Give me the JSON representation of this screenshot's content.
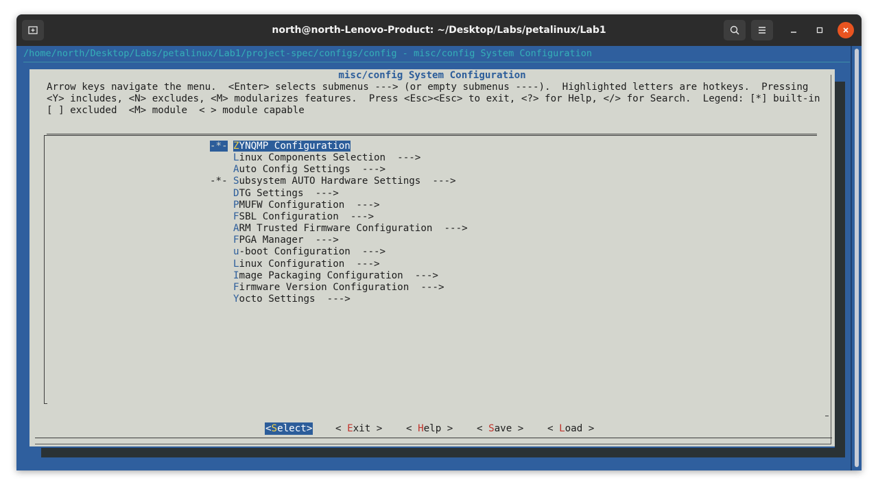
{
  "window": {
    "title": "north@north-Lenovo-Product: ~/Desktop/Labs/petalinux/Lab1"
  },
  "terminal": {
    "path_line": "/home/north/Desktop/Labs/petalinux/Lab1/project-spec/configs/config - misc/config System Configuration"
  },
  "dialog": {
    "title": "misc/config System Configuration",
    "help_lines": [
      "Arrow keys navigate the menu.  <Enter> selects submenus ---> (or empty submenus ----).  Highlighted letters are hotkeys.  Pressing",
      "<Y> includes, <N> excludes, <M> modularizes features.  Press <Esc><Esc> to exit, <?> for Help, </> for Search.  Legend: [*] built-in",
      "[ ] excluded  <M> module  < > module capable"
    ]
  },
  "menu": {
    "items": [
      {
        "prefix": "-*-",
        "hotkey": "Z",
        "rest": "YNQMP Configuration",
        "arrow": "",
        "selected": true
      },
      {
        "prefix": "",
        "hotkey": "L",
        "rest": "inux Components Selection",
        "arrow": "  --->",
        "selected": false
      },
      {
        "prefix": "",
        "hotkey": "A",
        "rest": "uto Config Settings",
        "arrow": "  --->",
        "selected": false
      },
      {
        "prefix": "-*-",
        "hotkey": "S",
        "rest": "ubsystem AUTO Hardware Settings",
        "arrow": "  --->",
        "selected": false
      },
      {
        "prefix": "",
        "hotkey": "D",
        "rest": "TG Settings",
        "arrow": "  --->",
        "selected": false
      },
      {
        "prefix": "",
        "hotkey": "P",
        "rest": "MUFW Configuration",
        "arrow": "  --->",
        "selected": false
      },
      {
        "prefix": "",
        "hotkey": "F",
        "rest": "SBL Configuration",
        "arrow": "  --->",
        "selected": false
      },
      {
        "prefix": "",
        "hotkey": "A",
        "rest": "RM Trusted Firmware Configuration",
        "arrow": "  --->",
        "selected": false
      },
      {
        "prefix": "",
        "hotkey": "F",
        "rest": "PGA Manager",
        "arrow": "  --->",
        "selected": false
      },
      {
        "prefix": "",
        "hotkey": "u",
        "rest": "-boot Configuration",
        "arrow": "  --->",
        "selected": false
      },
      {
        "prefix": "",
        "hotkey": "L",
        "rest": "inux Configuration",
        "arrow": "  --->",
        "selected": false
      },
      {
        "prefix": "",
        "hotkey": "I",
        "rest": "mage Packaging Configuration",
        "arrow": "  --->",
        "selected": false
      },
      {
        "prefix": "",
        "hotkey": "F",
        "rest": "irmware Version Configuration",
        "arrow": "  --->",
        "selected": false
      },
      {
        "prefix": "",
        "hotkey": "Y",
        "rest": "octo Settings",
        "arrow": "  --->",
        "selected": false
      }
    ]
  },
  "buttons": {
    "select": {
      "open": "<",
      "hotkey": "S",
      "rest": "elect",
      "close": ">"
    },
    "exit": {
      "open": "< ",
      "hotkey": "E",
      "rest": "xit",
      "close": " >"
    },
    "help": {
      "open": "< ",
      "hotkey": "H",
      "rest": "elp",
      "close": " >"
    },
    "save": {
      "open": "< ",
      "hotkey": "S",
      "rest": "ave",
      "close": " >"
    },
    "load": {
      "open": "< ",
      "hotkey": "L",
      "rest": "oad",
      "close": " >"
    }
  },
  "colors": {
    "terminal_bg": "#2f5f9e",
    "dialog_bg": "#d4d6ce",
    "hotkey_blue": "#2c5d9a",
    "hotkey_red": "#c0332b",
    "selected_hotkey": "#f2d24a",
    "close_button": "#e95420"
  },
  "icons": {
    "new_tab": "new-tab-icon",
    "search": "search-icon",
    "menu": "hamburger-menu-icon",
    "minimize": "minimize-icon",
    "maximize": "maximize-icon",
    "close": "close-icon"
  }
}
